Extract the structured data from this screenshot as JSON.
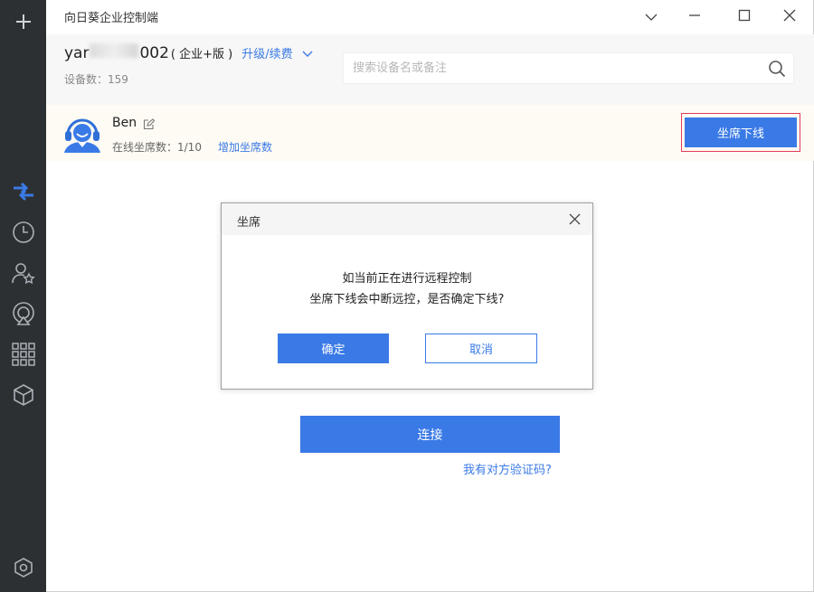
{
  "app": {
    "title": "向日葵企业控制端"
  },
  "window_controls": [
    "chevron-down-icon",
    "minimize-icon",
    "maximize-icon",
    "close-icon"
  ],
  "sidebar": {
    "items": [
      {
        "icon": "plus-icon",
        "active": false
      },
      {
        "icon": "remote-control-arrows-icon",
        "active": true
      },
      {
        "icon": "history-clock-icon",
        "active": false
      },
      {
        "icon": "user-star-icon",
        "active": false
      },
      {
        "icon": "screen-cast-icon",
        "active": false
      },
      {
        "icon": "apps-grid-icon",
        "active": false
      },
      {
        "icon": "cube-icon",
        "active": false
      },
      {
        "icon": "settings-hexagon-icon",
        "active": false
      }
    ]
  },
  "account": {
    "name_prefix": "yar",
    "name_suffix": "002",
    "edition": "( 企业+版 )",
    "upgrade_label": "升级/续费",
    "device_count": "设备数：159"
  },
  "search": {
    "placeholder": "搜索设备名或备注",
    "value": ""
  },
  "seat": {
    "name": "Ben",
    "online_label": "在线坐席数：1/10",
    "add_seat_label": "增加坐席数",
    "offline_button": "坐席下线"
  },
  "main": {
    "connect_button": "连接",
    "verify_link": "我有对方验证码?"
  },
  "dialog": {
    "title": "坐席",
    "message_line1": "如当前正在进行远程控制",
    "message_line2": "坐席下线会中断远控，是否确定下线?",
    "ok_button": "确定",
    "cancel_button": "取消"
  },
  "colors": {
    "accent": "#3a7ae6",
    "sidebar_bg": "#2d3033",
    "highlight_border": "#e03c5a"
  }
}
